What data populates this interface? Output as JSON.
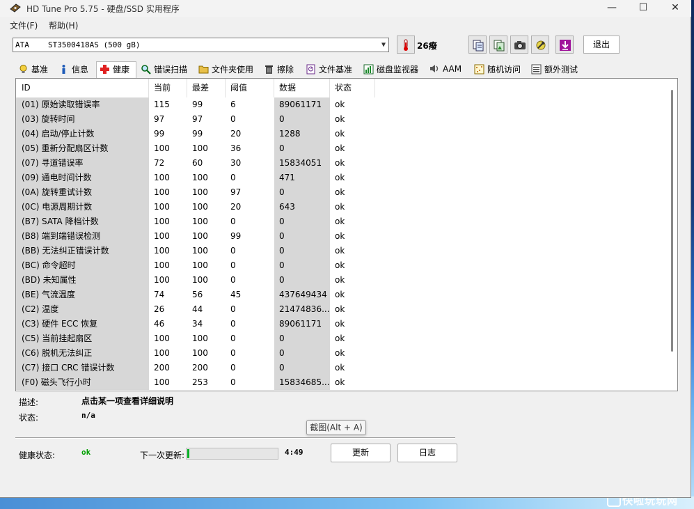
{
  "window": {
    "title": "HD Tune Pro 5.75 - 硬盘/SSD 实用程序",
    "minimize": "—",
    "maximize": "☐",
    "close": "✕"
  },
  "menu": {
    "file": "文件(F)",
    "help": "帮助(H)"
  },
  "device": {
    "interface": "ATA",
    "model": "ST3500418AS (500 gB)",
    "temperature": "26癈"
  },
  "toolbar": {
    "exit": "退出"
  },
  "tabs": [
    {
      "label": "基准",
      "icon": "lightbulb-icon"
    },
    {
      "label": "信息",
      "icon": "info-icon"
    },
    {
      "label": "健康",
      "icon": "health-cross-icon"
    },
    {
      "label": "错误扫描",
      "icon": "magnifier-icon"
    },
    {
      "label": "文件夹使用",
      "icon": "folder-icon"
    },
    {
      "label": "擦除",
      "icon": "trash-icon"
    },
    {
      "label": "文件基准",
      "icon": "file-benchmark-icon"
    },
    {
      "label": "磁盘监视器",
      "icon": "disk-monitor-icon"
    },
    {
      "label": "AAM",
      "icon": "speaker-icon"
    },
    {
      "label": "随机访问",
      "icon": "random-access-icon"
    },
    {
      "label": "额外测试",
      "icon": "extra-tests-icon"
    }
  ],
  "table": {
    "headers": {
      "id": "ID",
      "current": "当前",
      "worst": "最差",
      "threshold": "阈值",
      "data": "数据",
      "status": "状态"
    },
    "rows": [
      {
        "id": "(01) 原始读取错误率",
        "current": "115",
        "worst": "99",
        "threshold": "6",
        "data": "89061171",
        "status": "ok"
      },
      {
        "id": "(03) 旋转时间",
        "current": "97",
        "worst": "97",
        "threshold": "0",
        "data": "0",
        "status": "ok"
      },
      {
        "id": "(04) 启动/停止计数",
        "current": "99",
        "worst": "99",
        "threshold": "20",
        "data": "1288",
        "status": "ok"
      },
      {
        "id": "(05) 重新分配扇区计数",
        "current": "100",
        "worst": "100",
        "threshold": "36",
        "data": "0",
        "status": "ok"
      },
      {
        "id": "(07) 寻道错误率",
        "current": "72",
        "worst": "60",
        "threshold": "30",
        "data": "15834051",
        "status": "ok"
      },
      {
        "id": "(09) 通电时间计数",
        "current": "100",
        "worst": "100",
        "threshold": "0",
        "data": "471",
        "status": "ok"
      },
      {
        "id": "(0A) 旋转重试计数",
        "current": "100",
        "worst": "100",
        "threshold": "97",
        "data": "0",
        "status": "ok"
      },
      {
        "id": "(0C) 电源周期计数",
        "current": "100",
        "worst": "100",
        "threshold": "20",
        "data": "643",
        "status": "ok"
      },
      {
        "id": "(B7) SATA 降档计数",
        "current": "100",
        "worst": "100",
        "threshold": "0",
        "data": "0",
        "status": "ok"
      },
      {
        "id": "(B8) 端到端错误检测",
        "current": "100",
        "worst": "100",
        "threshold": "99",
        "data": "0",
        "status": "ok"
      },
      {
        "id": "(BB) 无法纠正错误计数",
        "current": "100",
        "worst": "100",
        "threshold": "0",
        "data": "0",
        "status": "ok"
      },
      {
        "id": "(BC) 命令超时",
        "current": "100",
        "worst": "100",
        "threshold": "0",
        "data": "0",
        "status": "ok"
      },
      {
        "id": "(BD) 未知属性",
        "current": "100",
        "worst": "100",
        "threshold": "0",
        "data": "0",
        "status": "ok"
      },
      {
        "id": "(BE) 气流温度",
        "current": "74",
        "worst": "56",
        "threshold": "45",
        "data": "437649434",
        "status": "ok"
      },
      {
        "id": "(C2) 温度",
        "current": "26",
        "worst": "44",
        "threshold": "0",
        "data": "21474836...",
        "status": "ok"
      },
      {
        "id": "(C3) 硬件 ECC 恢复",
        "current": "46",
        "worst": "34",
        "threshold": "0",
        "data": "89061171",
        "status": "ok"
      },
      {
        "id": "(C5) 当前挂起扇区",
        "current": "100",
        "worst": "100",
        "threshold": "0",
        "data": "0",
        "status": "ok"
      },
      {
        "id": "(C6) 脱机无法纠正",
        "current": "100",
        "worst": "100",
        "threshold": "0",
        "data": "0",
        "status": "ok"
      },
      {
        "id": "(C7) 接口 CRC 错误计数",
        "current": "200",
        "worst": "200",
        "threshold": "0",
        "data": "0",
        "status": "ok"
      },
      {
        "id": "(F0) 磁头飞行小时",
        "current": "100",
        "worst": "253",
        "threshold": "0",
        "data": "15834685...",
        "status": "ok"
      }
    ]
  },
  "details": {
    "description_label": "描述:",
    "description_value": "点击某一项查看详细说明",
    "status_label": "状态:",
    "status_value": "n/a"
  },
  "tooltip": "截图(Alt + A)",
  "footer": {
    "health_label": "健康状态:",
    "health_value": "ok",
    "next_update_label": "下一次更新:",
    "countdown": "4:49",
    "progress": 0.02,
    "refresh_button": "更新",
    "log_button": "日志"
  },
  "watermark": "快啦玩玩网",
  "colors": {
    "health_ok": "#00a000",
    "progress": "#06b025"
  }
}
